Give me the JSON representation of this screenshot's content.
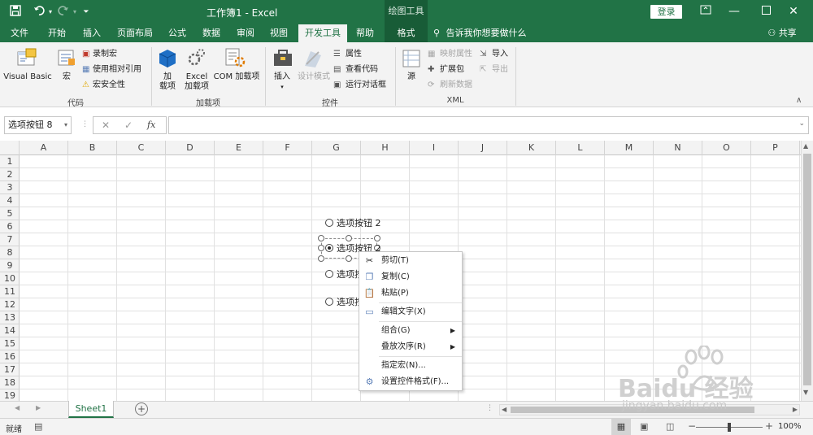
{
  "titlebar": {
    "doc_title": "工作簿1  -  Excel",
    "context_tab": "绘图工具",
    "login": "登录",
    "save_icon": "save-icon",
    "undo_icon": "undo-icon",
    "redo_icon": "redo-icon",
    "customize_icon": "customize-icon"
  },
  "tabs": [
    "文件",
    "开始",
    "插入",
    "页面布局",
    "公式",
    "数据",
    "审阅",
    "视图",
    "开发工具",
    "帮助",
    "格式"
  ],
  "active_tab": "开发工具",
  "tell_me": "告诉我你想要做什么",
  "share": "共享",
  "ribbon": {
    "code_group": {
      "label": "代码",
      "vba": "Visual Basic",
      "macro": "宏",
      "record": "录制宏",
      "relative": "使用相对引用",
      "security": "宏安全性"
    },
    "addins_group": {
      "label": "加载项",
      "addin": "加\n载项",
      "addin_l1": "加",
      "addin_l2": "载项",
      "excel_addin_l1": "Excel",
      "excel_addin_l2": "加载项",
      "com_addin": "COM 加载项"
    },
    "controls_group": {
      "label": "控件",
      "insert": "插入",
      "design_mode": "设计模式",
      "properties": "属性",
      "view_code": "查看代码",
      "run_dialog": "运行对话框"
    },
    "xml_group": {
      "label": "XML",
      "source": "源",
      "map_props": "映射属性",
      "expansion": "扩展包",
      "refresh": "刷新数据",
      "import": "导入",
      "export": "导出"
    }
  },
  "formula_bar": {
    "name_box": "选项按钮 8",
    "cancel": "✕",
    "enter": "✓",
    "fx": "fx",
    "value": ""
  },
  "columns": [
    "A",
    "B",
    "C",
    "D",
    "E",
    "F",
    "G",
    "H",
    "I",
    "J",
    "K",
    "L",
    "M",
    "N",
    "O",
    "P"
  ],
  "rows": [
    "1",
    "2",
    "3",
    "4",
    "5",
    "6",
    "7",
    "8",
    "9",
    "10",
    "11",
    "12",
    "13",
    "14",
    "15",
    "16",
    "17",
    "18",
    "19"
  ],
  "option_buttons": [
    {
      "label": "选项按钮 2",
      "checked": false
    },
    {
      "label": "选项按钮 2",
      "checked": true
    },
    {
      "label": "选项按",
      "checked": false
    },
    {
      "label": "选项按",
      "checked": false
    }
  ],
  "context_menu": [
    {
      "label": "剪切(T)",
      "icon": "scissors-icon",
      "sub": false,
      "disabled": false
    },
    {
      "label": "复制(C)",
      "icon": "copy-icon",
      "sub": false,
      "disabled": false
    },
    {
      "label": "粘贴(P)",
      "icon": "paste-icon",
      "sub": false,
      "disabled": false
    },
    {
      "label": "编辑文字(X)",
      "icon": "edit-text-icon",
      "sub": false,
      "disabled": false
    },
    {
      "label": "组合(G)",
      "icon": "",
      "sub": true,
      "disabled": false
    },
    {
      "label": "叠放次序(R)",
      "icon": "",
      "sub": true,
      "disabled": false
    },
    {
      "label": "指定宏(N)...",
      "icon": "",
      "sub": false,
      "disabled": false
    },
    {
      "label": "设置控件格式(F)...",
      "icon": "format-control-icon",
      "sub": false,
      "disabled": false
    }
  ],
  "sheet_tabs": [
    "Sheet1"
  ],
  "status": {
    "mode": "就绪",
    "zoom": "100%"
  },
  "watermark": {
    "brand": "Baidu 经验",
    "url": "jingyan.baidu.com"
  },
  "colors": {
    "excel_green": "#217346",
    "dark_green": "#185c37"
  }
}
